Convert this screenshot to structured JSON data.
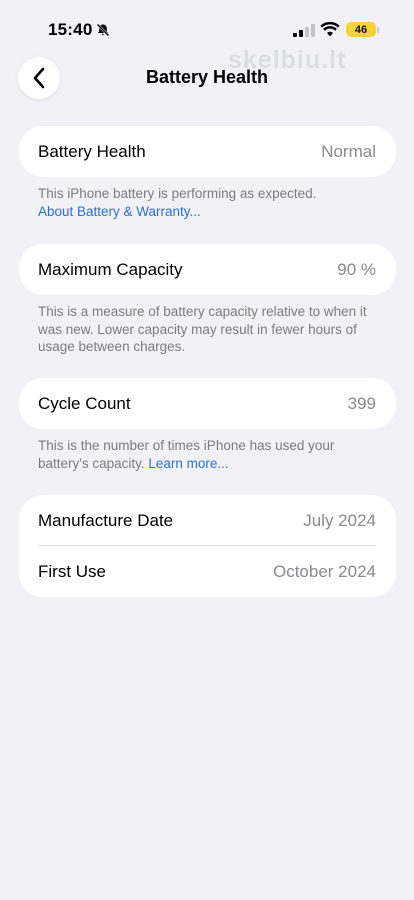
{
  "status_bar": {
    "time": "15:40",
    "battery_level": "46",
    "battery_color": "#f7d33a",
    "icons": [
      "bell-slash-icon",
      "cellular-signal-icon",
      "wifi-icon",
      "battery-icon"
    ]
  },
  "watermark": "skelbiu.lt",
  "header": {
    "title": "Battery Health",
    "back_icon": "chevron-left-icon"
  },
  "battery_health": {
    "label": "Battery Health",
    "value": "Normal",
    "note": "This iPhone battery is performing as expected.",
    "link": "About Battery & Warranty..."
  },
  "maximum_capacity": {
    "label": "Maximum Capacity",
    "value": "90 %",
    "note": "This is a measure of battery capacity relative to when it was new. Lower capacity may result in fewer hours of usage between charges."
  },
  "cycle_count": {
    "label": "Cycle Count",
    "value": "399",
    "note": "This is the number of times iPhone has used your battery's capacity.",
    "link": "Learn more..."
  },
  "dates": {
    "manufacture_label": "Manufacture Date",
    "manufacture_value": "July 2024",
    "first_use_label": "First Use",
    "first_use_value": "October 2024"
  },
  "colors": {
    "background": "#f1f1f6",
    "link": "#2d6fd2",
    "secondary_text": "#8a8a8e"
  }
}
